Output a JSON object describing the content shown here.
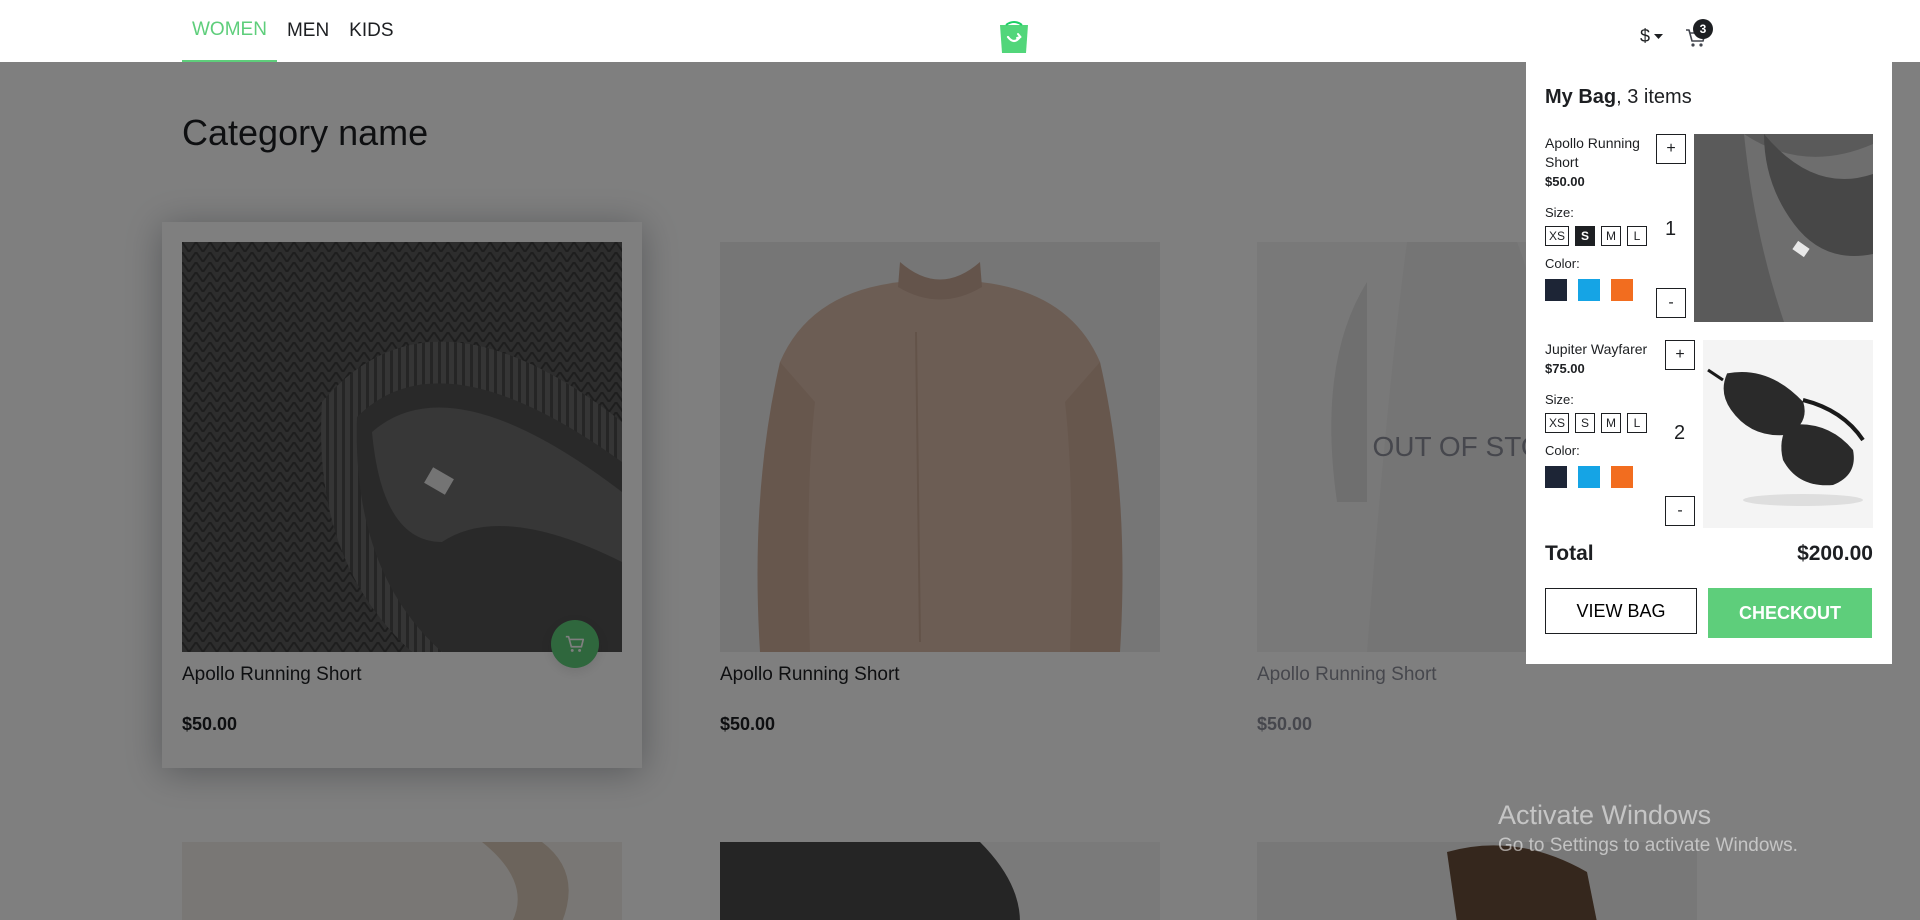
{
  "nav": {
    "items": [
      {
        "label": "WOMEN",
        "active": true
      },
      {
        "label": "MEN",
        "active": false
      },
      {
        "label": "KIDS",
        "active": false
      }
    ],
    "currency": "$",
    "cart_count": "3",
    "logo_icon": "green-bag-logo-icon"
  },
  "page": {
    "title": "Category name"
  },
  "products": [
    {
      "name": "Apollo Running Short",
      "price": "$50.00",
      "in_stock": true,
      "hovered": true,
      "image": "knit-sweater-collar"
    },
    {
      "name": "Apollo Running Short",
      "price": "$50.00",
      "in_stock": true,
      "hovered": false,
      "image": "beige-sweater"
    },
    {
      "name": "Apollo Running Short",
      "price": "$50.00",
      "in_stock": false,
      "oos_label": "OUT OF STOCK",
      "image": "white-dress"
    }
  ],
  "minicart": {
    "title": "My Bag",
    "count_text": ", 3 items",
    "size_label": "Size:",
    "color_label": "Color:",
    "items": [
      {
        "name": "Apollo Running Short",
        "price": "$50.00",
        "sizes": [
          "XS",
          "S",
          "M",
          "L"
        ],
        "selected_size": "S",
        "colors": [
          "#1d2536",
          "#15a4e5",
          "#f26d1f"
        ],
        "quantity": "1",
        "plus": "+",
        "minus": "-"
      },
      {
        "name": "Jupiter Wayfarer",
        "price": "$75.00",
        "sizes": [
          "XS",
          "S",
          "M",
          "L"
        ],
        "selected_size": "",
        "colors": [
          "#1d2536",
          "#15a4e5",
          "#f26d1f"
        ],
        "quantity": "2",
        "plus": "+",
        "minus": "-"
      }
    ],
    "total_label": "Total",
    "total_value": "$200.00",
    "view_bag": "VIEW BAG",
    "checkout": "CHECKOUT"
  },
  "watermark": {
    "line1": "Activate Windows",
    "line2": "Go to Settings to activate Windows."
  },
  "colors": {
    "accent": "#5ece7b",
    "text": "#1d1f22",
    "overlay": "rgba(0,0,0,0.5)"
  }
}
